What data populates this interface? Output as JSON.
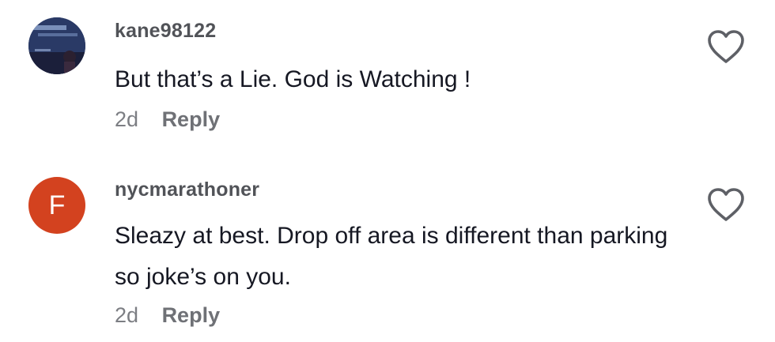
{
  "comments": [
    {
      "username": "kane98122",
      "avatar_icon": "user-photo-icon",
      "text": "But that’s a Lie. God is Watching !",
      "time": "2d",
      "reply_label": "Reply",
      "like_icon": "heart-outline-icon"
    },
    {
      "username": "nycmarathoner",
      "avatar_letter": "F",
      "avatar_color": "#d3421f",
      "text": "Sleazy at best. Drop off area is different than parking so joke’s on you.",
      "time": "2d",
      "reply_label": "Reply",
      "like_icon": "heart-outline-icon"
    }
  ]
}
